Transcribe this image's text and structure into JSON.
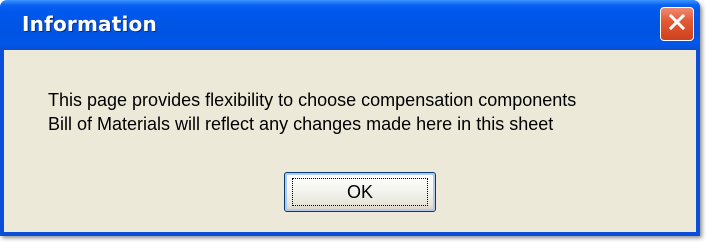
{
  "dialog": {
    "title": "Information",
    "message_lines": [
      "This page provides flexibility to choose compensation components",
      "Bill of Materials will reflect any changes made here in this sheet"
    ],
    "ok_label": "OK",
    "close_icon": "close-icon"
  },
  "colors": {
    "titlebar": "#0054e3",
    "client_bg": "#ece9d8",
    "close_button": "#e25a36",
    "title_text": "#ffffff"
  }
}
